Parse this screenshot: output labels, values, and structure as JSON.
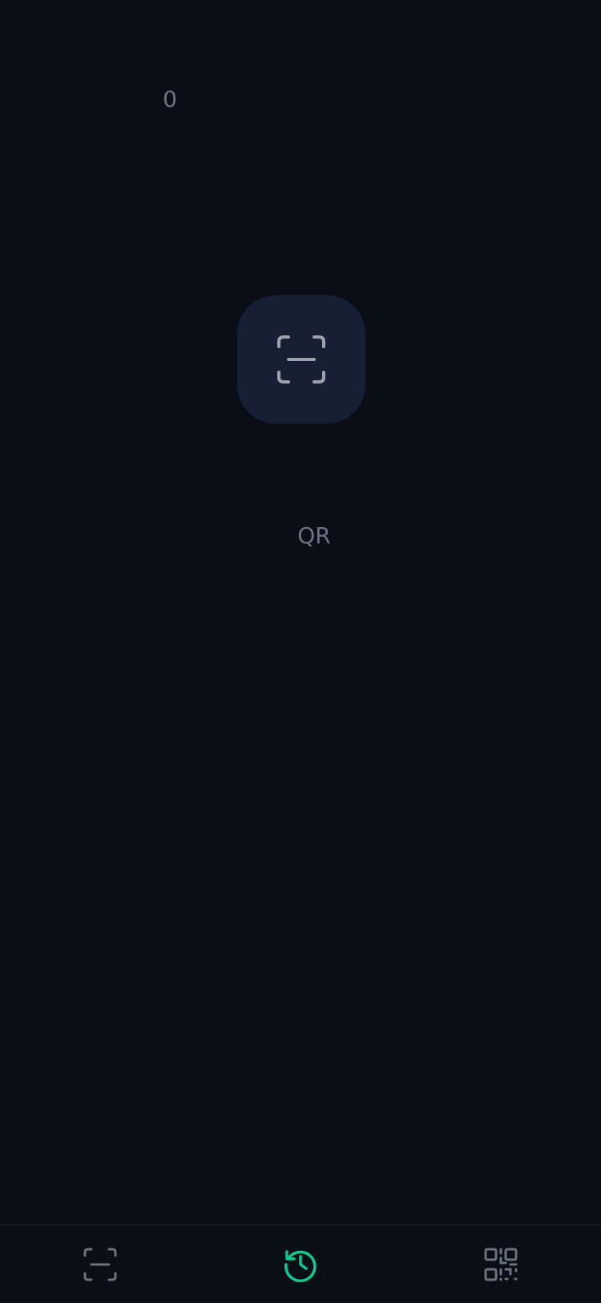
{
  "history": {
    "count": "0",
    "empty_label": "QR"
  },
  "icons": {
    "scan_tile": "scan-frame-icon",
    "nav_scan": "scan-frame-icon",
    "nav_history": "history-clock-icon",
    "nav_generate": "qr-code-icon"
  },
  "colors": {
    "background": "#0a0e17",
    "tile": "#161f33",
    "muted": "#6b7280",
    "accent": "#10c98f"
  },
  "bottom_nav": {
    "active": "history"
  }
}
